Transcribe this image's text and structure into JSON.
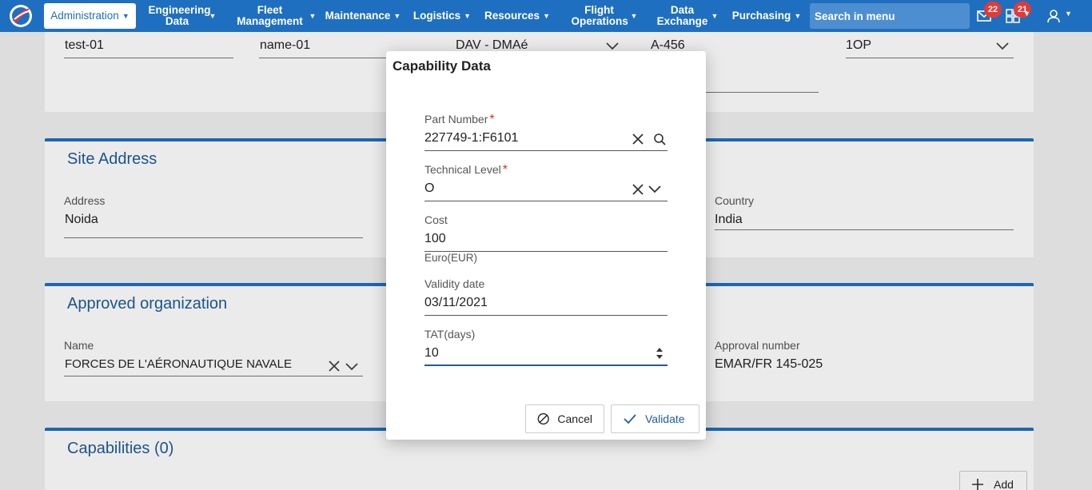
{
  "nav": {
    "items": [
      {
        "label": "Administration"
      },
      {
        "label": "Engineering Data"
      },
      {
        "label": "Fleet Management"
      },
      {
        "label": "Maintenance"
      },
      {
        "label": "Logistics"
      },
      {
        "label": "Resources"
      },
      {
        "label": "Flight Operations"
      },
      {
        "label": "Data Exchange"
      },
      {
        "label": "Purchasing"
      }
    ],
    "search_placeholder": "Search in menu",
    "mail_count": "22",
    "tasks_count": "21",
    "icons": [
      "logo-icon",
      "mail-icon",
      "tasks-icon",
      "user-icon"
    ],
    "accent_color": "#1f6fc0"
  },
  "background": {
    "top_row": {
      "code": "test-01",
      "name": "name-01",
      "type": "DAV - DMAé",
      "reference": "A-456",
      "option": "1OP"
    },
    "site_address": {
      "title": "Site Address",
      "address_label": "Address",
      "address_value": "Noida",
      "country_label": "Country",
      "country_value": "India"
    },
    "approved_org": {
      "title": "Approved organization",
      "name_label": "Name",
      "name_value": "FORCES DE L'AÉRONAUTIQUE NAVALE",
      "approval_label": "Approval number",
      "approval_value": "EMAR/FR 145-025"
    },
    "capabilities": {
      "title": "Capabilities (0)",
      "add_label": "Add"
    }
  },
  "dialog": {
    "title": "Capability Data",
    "part_number": {
      "label": "Part Number",
      "required": "*",
      "value": "227749-1:F6101"
    },
    "technical_level": {
      "label": "Technical Level",
      "required": "*",
      "value": "O"
    },
    "cost": {
      "label": "Cost",
      "value": "100",
      "hint": "Euro(EUR)"
    },
    "validity_date": {
      "label": "Validity date",
      "value": "03/11/2021"
    },
    "tat": {
      "label": "TAT(days)",
      "value": "10"
    },
    "cancel_label": "Cancel",
    "validate_label": "Validate"
  }
}
